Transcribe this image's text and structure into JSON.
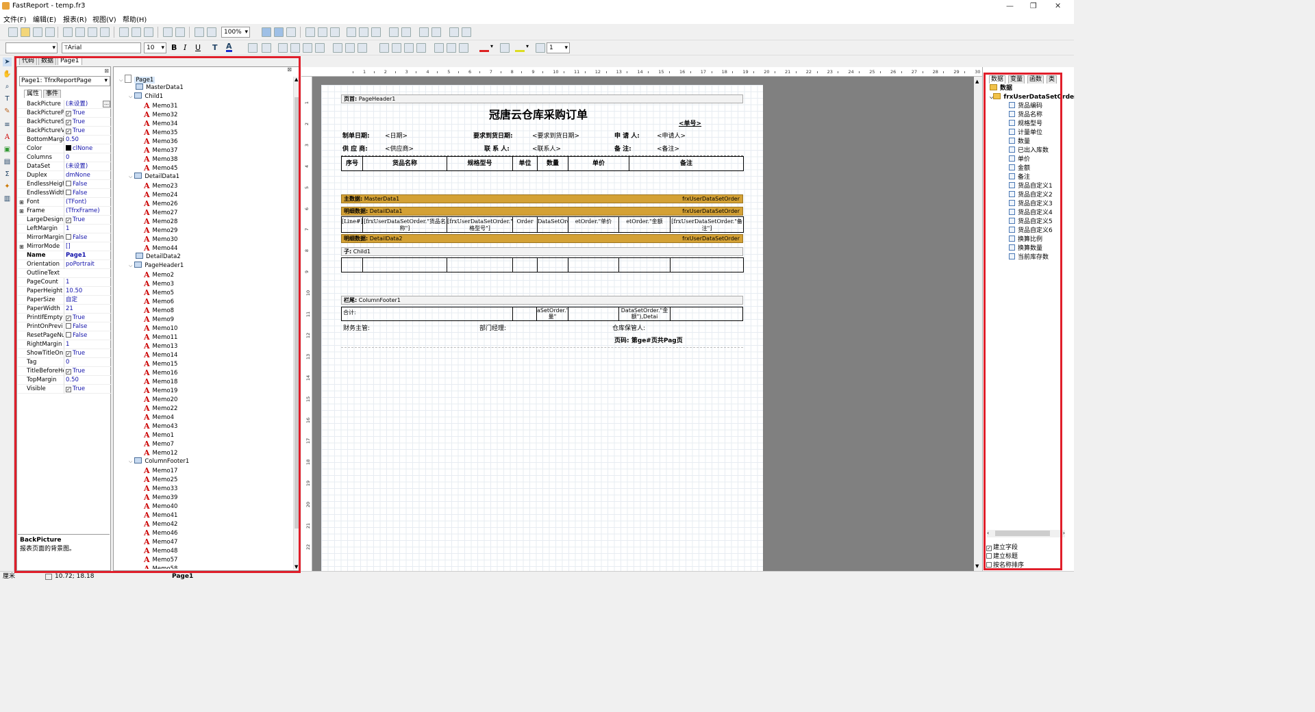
{
  "window": {
    "title": "FastReport - temp.fr3"
  },
  "menu": [
    "文件(F)",
    "编辑(E)",
    "报表(R)",
    "视图(V)",
    "帮助(H)"
  ],
  "toolbar": {
    "zoom": "100%",
    "font": "Arial",
    "font_size": "10",
    "line_width": "1"
  },
  "tabs": [
    "代码",
    "数据",
    "Page1"
  ],
  "inspector": {
    "selector": "Page1: TfrxReportPage",
    "tabs": [
      "属性",
      "事件"
    ],
    "props": [
      {
        "n": "BackPicture",
        "v": "(未设置)",
        "dots": true
      },
      {
        "n": "BackPicturePr",
        "v": "True",
        "chk": true
      },
      {
        "n": "BackPictureSt",
        "v": "True",
        "chk": true
      },
      {
        "n": "BackPictureVi",
        "v": "True",
        "chk": true
      },
      {
        "n": "BottomMargin",
        "v": "0.50"
      },
      {
        "n": "Color",
        "v": "clNone",
        "swatch": true
      },
      {
        "n": "Columns",
        "v": "0"
      },
      {
        "n": "DataSet",
        "v": "(未设置)"
      },
      {
        "n": "Duplex",
        "v": "dmNone"
      },
      {
        "n": "EndlessHeigh",
        "v": "False",
        "chk": false
      },
      {
        "n": "EndlessWidth",
        "v": "False",
        "chk": false
      },
      {
        "n": "Font",
        "v": "(TFont)",
        "plus": true
      },
      {
        "n": "Frame",
        "v": "(TfrxFrame)",
        "plus": true
      },
      {
        "n": "LargeDesign",
        "v": "True",
        "chk": true
      },
      {
        "n": "LeftMargin",
        "v": "1"
      },
      {
        "n": "MirrorMargin",
        "v": "False",
        "chk": false
      },
      {
        "n": "MirrorMode",
        "v": "[]",
        "plus": true
      },
      {
        "n": "Name",
        "v": "Page1",
        "bold": true
      },
      {
        "n": "Orientation",
        "v": "poPortrait"
      },
      {
        "n": "OutlineText",
        "v": ""
      },
      {
        "n": "PageCount",
        "v": "1"
      },
      {
        "n": "PaperHeight",
        "v": "10.50"
      },
      {
        "n": "PaperSize",
        "v": "自定"
      },
      {
        "n": "PaperWidth",
        "v": "21"
      },
      {
        "n": "PrintIfEmpty",
        "v": "True",
        "chk": true
      },
      {
        "n": "PrintOnPrevi",
        "v": "False",
        "chk": false
      },
      {
        "n": "ResetPageNu",
        "v": "False",
        "chk": false
      },
      {
        "n": "RightMargin",
        "v": "1"
      },
      {
        "n": "ShowTitleOnF",
        "v": "True",
        "chk": true
      },
      {
        "n": "Tag",
        "v": "0"
      },
      {
        "n": "TitleBeforeHe",
        "v": "True",
        "chk": true
      },
      {
        "n": "TopMargin",
        "v": "0.50"
      },
      {
        "n": "Visible",
        "v": "True",
        "chk": true
      }
    ],
    "desc_title": "BackPicture",
    "desc_text": "报表页面的背景图。"
  },
  "tree": [
    {
      "t": "Page1",
      "l": 0,
      "k": "page"
    },
    {
      "t": "MasterData1",
      "l": 1,
      "k": "band"
    },
    {
      "t": "Child1",
      "l": 1,
      "k": "band",
      "exp": true
    },
    {
      "t": "Memo31",
      "l": 2,
      "k": "memo"
    },
    {
      "t": "Memo32",
      "l": 2,
      "k": "memo"
    },
    {
      "t": "Memo34",
      "l": 2,
      "k": "memo"
    },
    {
      "t": "Memo35",
      "l": 2,
      "k": "memo"
    },
    {
      "t": "Memo36",
      "l": 2,
      "k": "memo"
    },
    {
      "t": "Memo37",
      "l": 2,
      "k": "memo"
    },
    {
      "t": "Memo38",
      "l": 2,
      "k": "memo"
    },
    {
      "t": "Memo45",
      "l": 2,
      "k": "memo"
    },
    {
      "t": "DetailData1",
      "l": 1,
      "k": "band",
      "exp": true
    },
    {
      "t": "Memo23",
      "l": 2,
      "k": "memo"
    },
    {
      "t": "Memo24",
      "l": 2,
      "k": "memo"
    },
    {
      "t": "Memo26",
      "l": 2,
      "k": "memo"
    },
    {
      "t": "Memo27",
      "l": 2,
      "k": "memo"
    },
    {
      "t": "Memo28",
      "l": 2,
      "k": "memo"
    },
    {
      "t": "Memo29",
      "l": 2,
      "k": "memo"
    },
    {
      "t": "Memo30",
      "l": 2,
      "k": "memo"
    },
    {
      "t": "Memo44",
      "l": 2,
      "k": "memo"
    },
    {
      "t": "DetailData2",
      "l": 1,
      "k": "band"
    },
    {
      "t": "PageHeader1",
      "l": 1,
      "k": "band",
      "exp": true
    },
    {
      "t": "Memo2",
      "l": 2,
      "k": "memo"
    },
    {
      "t": "Memo3",
      "l": 2,
      "k": "memo"
    },
    {
      "t": "Memo5",
      "l": 2,
      "k": "memo"
    },
    {
      "t": "Memo6",
      "l": 2,
      "k": "memo"
    },
    {
      "t": "Memo8",
      "l": 2,
      "k": "memo"
    },
    {
      "t": "Memo9",
      "l": 2,
      "k": "memo"
    },
    {
      "t": "Memo10",
      "l": 2,
      "k": "memo"
    },
    {
      "t": "Memo11",
      "l": 2,
      "k": "memo"
    },
    {
      "t": "Memo13",
      "l": 2,
      "k": "memo"
    },
    {
      "t": "Memo14",
      "l": 2,
      "k": "memo"
    },
    {
      "t": "Memo15",
      "l": 2,
      "k": "memo"
    },
    {
      "t": "Memo16",
      "l": 2,
      "k": "memo"
    },
    {
      "t": "Memo18",
      "l": 2,
      "k": "memo"
    },
    {
      "t": "Memo19",
      "l": 2,
      "k": "memo"
    },
    {
      "t": "Memo20",
      "l": 2,
      "k": "memo"
    },
    {
      "t": "Memo22",
      "l": 2,
      "k": "memo"
    },
    {
      "t": "Memo4",
      "l": 2,
      "k": "memo"
    },
    {
      "t": "Memo43",
      "l": 2,
      "k": "memo"
    },
    {
      "t": "Memo1",
      "l": 2,
      "k": "memo"
    },
    {
      "t": "Memo7",
      "l": 2,
      "k": "memo"
    },
    {
      "t": "Memo12",
      "l": 2,
      "k": "memo"
    },
    {
      "t": "ColumnFooter1",
      "l": 1,
      "k": "band",
      "exp": true
    },
    {
      "t": "Memo17",
      "l": 2,
      "k": "memo"
    },
    {
      "t": "Memo25",
      "l": 2,
      "k": "memo"
    },
    {
      "t": "Memo33",
      "l": 2,
      "k": "memo"
    },
    {
      "t": "Memo39",
      "l": 2,
      "k": "memo"
    },
    {
      "t": "Memo40",
      "l": 2,
      "k": "memo"
    },
    {
      "t": "Memo41",
      "l": 2,
      "k": "memo"
    },
    {
      "t": "Memo42",
      "l": 2,
      "k": "memo"
    },
    {
      "t": "Memo46",
      "l": 2,
      "k": "memo"
    },
    {
      "t": "Memo47",
      "l": 2,
      "k": "memo"
    },
    {
      "t": "Memo48",
      "l": 2,
      "k": "memo"
    },
    {
      "t": "Memo57",
      "l": 2,
      "k": "memo"
    },
    {
      "t": "Memo58",
      "l": 2,
      "k": "memo"
    }
  ],
  "ruler": {
    "h": [
      "1",
      "2",
      "3",
      "4",
      "5",
      "6",
      "7",
      "8",
      "9",
      "10",
      "11",
      "12",
      "13",
      "14",
      "15",
      "16",
      "17",
      "18",
      "19",
      "20",
      "21",
      "22",
      "23",
      "24",
      "25",
      "26",
      "27",
      "28",
      "29",
      "30"
    ],
    "v": [
      "1",
      "2",
      "3",
      "4",
      "5",
      "6",
      "7",
      "8",
      "9",
      "10",
      "11",
      "12",
      "13",
      "14",
      "15",
      "16",
      "17",
      "18",
      "19",
      "20",
      "21",
      "22"
    ]
  },
  "report": {
    "pageheader": {
      "kind": "页首:",
      "name": "PageHeader1"
    },
    "title": "冠唐云仓库采购订单",
    "order_no": "<单号>",
    "row1": [
      {
        "l": "制单日期:",
        "v": "<日期>"
      },
      {
        "l": "要求到货日期:",
        "v": "<要求到货日期>"
      },
      {
        "l": "申 请 人:",
        "v": "<申请人>"
      }
    ],
    "row2": [
      {
        "l": "供 应 商:",
        "v": "<供应商>"
      },
      {
        "l": "联 系 人:",
        "v": "<联系人>"
      },
      {
        "l": "备    注:",
        "v": "<备注>"
      }
    ],
    "headers": [
      "序号",
      "货品名称",
      "规格型号",
      "单位",
      "数量",
      "单价",
      "备注"
    ],
    "master": {
      "kind": "主数据:",
      "name": "MasterData1",
      "ds": "frxUserDataSetOrder"
    },
    "detail1": {
      "kind": "明细数据:",
      "name": "DetailData1",
      "ds": "frxUserDataSetOrder"
    },
    "detail_cells": [
      "[Line#]",
      "[frxUserDataSetOrder.\"货品名称\"]",
      "[frxUserDataSetOrder.\"规格型号\"]",
      "Order",
      "DataSetOrder.\"数",
      "etOrder.\"单价",
      "etOrder.\"金额",
      "[frxUserDataSetOrder.\"备注\"]"
    ],
    "detail2": {
      "kind": "明细数据:",
      "name": "DetailData2",
      "ds": "frxUserDataSetOrder"
    },
    "child": {
      "kind": "子:",
      "name": "Child1"
    },
    "colfooter": {
      "kind": "栏尾:",
      "name": "ColumnFooter1"
    },
    "total_label": "合计:",
    "total_qty": "aSetOrder.\"数量\"",
    "total_amt": "DataSetOrder.\"金额\"),Detai",
    "signs": [
      "财务主管:",
      "部门经理:",
      "仓库保管人:"
    ],
    "page_num": [
      "页码:",
      "第",
      "ge#",
      "页共",
      "Pag",
      "页"
    ]
  },
  "rightpanel": {
    "tabs": [
      "数据",
      "变量",
      "函数",
      "类"
    ],
    "root": "数据",
    "dataset": "frxUserDataSetOrder",
    "fields": [
      "货品编码",
      "货品名称",
      "规格型号",
      "计量单位",
      "数量",
      "已出入库数",
      "单价",
      "金额",
      "备注",
      "货品自定义1",
      "货品自定义2",
      "货品自定义3",
      "货品自定义4",
      "货品自定义5",
      "货品自定义6",
      "换算比例",
      "换算数量",
      "当前库存数"
    ],
    "opts": [
      {
        "t": "建立字段",
        "c": true
      },
      {
        "t": "建立标题",
        "c": false
      },
      {
        "t": "按名称排序",
        "c": false
      }
    ]
  },
  "status": {
    "unit": "厘米",
    "pos": "10.72; 18.18",
    "page": "Page1"
  },
  "colors": {
    "band_orange": "#d4a135",
    "highlight": "#e01e2a"
  }
}
